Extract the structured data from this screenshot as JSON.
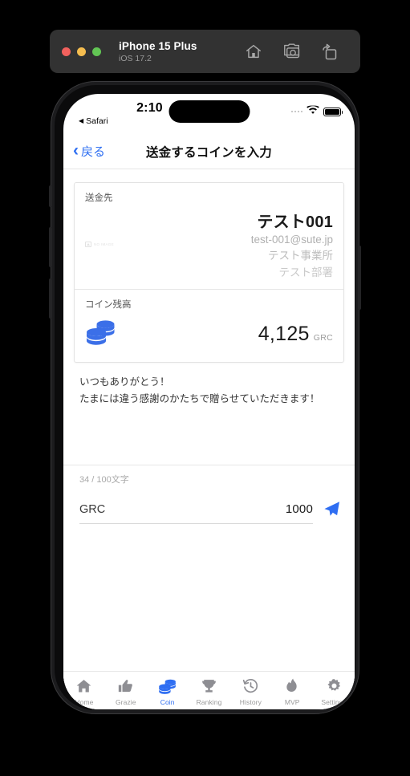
{
  "simulator": {
    "device_name": "iPhone 15 Plus",
    "os_version": "iOS 17.2",
    "actions": [
      {
        "name": "home-button",
        "icon": "home-icon"
      },
      {
        "name": "screenshot-button",
        "icon": "camera-icon"
      },
      {
        "name": "rotate-button",
        "icon": "rotate-icon"
      }
    ],
    "window_controls": [
      "close",
      "minimize",
      "zoom"
    ]
  },
  "status_bar": {
    "time": "2:10",
    "back_app": "Safari",
    "back_app_arrow": "◀",
    "wifi_icon": "wifi-icon",
    "battery_icon": "battery-icon"
  },
  "nav_bar": {
    "back_label": "戻る",
    "back_chevron": "‹",
    "title": "送金するコインを入力"
  },
  "recipient_card": {
    "label": "送金先",
    "avatar_placeholder": "NO IMAGE",
    "name": "テスト001",
    "email": "test-001@sute.jp",
    "organization": "テスト事業所",
    "department": "テスト部署"
  },
  "balance_card": {
    "label": "コイン残高",
    "icon": "coins-icon",
    "amount": "4,125",
    "unit": "GRC"
  },
  "message": {
    "line1": "いつもありがとう！",
    "line2": "たまには違う感謝のかたちで贈らせていただきます！",
    "counter": "34 / 100文字"
  },
  "amount_input": {
    "currency": "GRC",
    "value": "1000",
    "placeholder": "0",
    "send_icon": "send-paper-plane-icon"
  },
  "tab_bar": {
    "items": [
      {
        "label": "Home",
        "icon": "house-icon",
        "active": false
      },
      {
        "label": "Grazie",
        "icon": "thumbs-up-icon",
        "active": false
      },
      {
        "label": "Coin",
        "icon": "coins-icon",
        "active": true
      },
      {
        "label": "Ranking",
        "icon": "trophy-icon",
        "active": false
      },
      {
        "label": "History",
        "icon": "clock-history-icon",
        "active": false
      },
      {
        "label": "MVP",
        "icon": "flame-icon",
        "active": false
      },
      {
        "label": "Settings",
        "icon": "gear-icon",
        "active": false
      }
    ]
  },
  "colors": {
    "accent_blue": "#2f6ef2",
    "ios_link_blue": "#2e6ff2",
    "tab_inactive": "#9a9a9a",
    "background": "#ffffff",
    "chrome_dark": "#323232"
  }
}
